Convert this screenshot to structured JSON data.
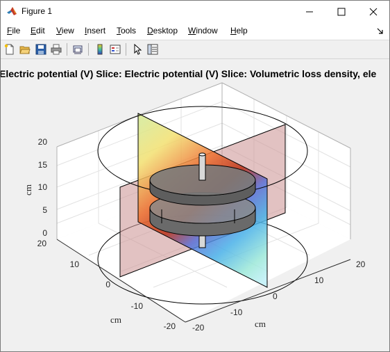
{
  "window": {
    "title": "Figure 1"
  },
  "menu": {
    "items": [
      {
        "label": "File",
        "key": "F",
        "rest": "ile"
      },
      {
        "label": "Edit",
        "key": "E",
        "rest": "dit"
      },
      {
        "label": "View",
        "key": "V",
        "rest": "iew"
      },
      {
        "label": "Insert",
        "key": "I",
        "rest": "nsert"
      },
      {
        "label": "Tools",
        "key": "T",
        "rest": "ools"
      },
      {
        "label": "Desktop",
        "key": "D",
        "rest": "esktop"
      },
      {
        "label": "Window",
        "key": "W",
        "rest": "indow"
      },
      {
        "label": "Help",
        "key": "H",
        "rest": "elp"
      }
    ]
  },
  "toolbar": {
    "icons": [
      "new-figure-icon",
      "open-file-icon",
      "save-icon",
      "print-icon",
      "link-plot-icon",
      "insert-colorbar-icon",
      "insert-legend-icon",
      "edit-plot-icon",
      "property-inspector-icon"
    ]
  },
  "plot": {
    "title": "Electric potential (V) Slice: Electric potential (V) Slice: Volumetric loss density, ele",
    "z_ticks": [
      "0",
      "5",
      "10",
      "15",
      "20"
    ],
    "z_label": "cm",
    "x_ticks": [
      "20",
      "10",
      "0",
      "-10",
      "-20"
    ],
    "x_label": "cm",
    "y_ticks": [
      "-20",
      "-10",
      "0",
      "10",
      "20"
    ],
    "y_label": "cm"
  }
}
